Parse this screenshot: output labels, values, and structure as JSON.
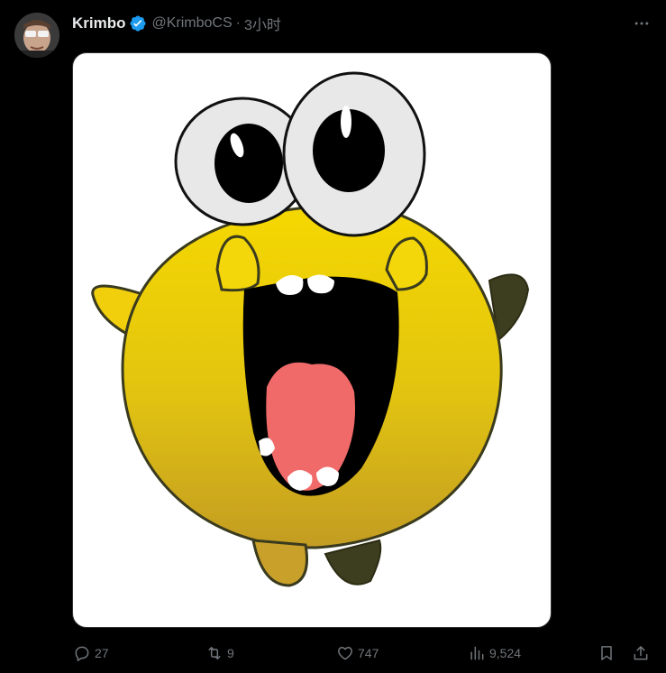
{
  "tweet": {
    "author": {
      "display_name": "Krimbo",
      "handle": "@KrimboCS",
      "verified": true
    },
    "separator": "·",
    "time": "3小时",
    "more_icon": "more-horizontal-icon",
    "media": {
      "kind": "image",
      "subject": "yellow cartoon creature"
    },
    "actions": {
      "reply": {
        "icon": "reply-icon",
        "count": "27"
      },
      "retweet": {
        "icon": "retweet-icon",
        "count": "9"
      },
      "like": {
        "icon": "heart-icon",
        "count": "747"
      },
      "views": {
        "icon": "views-chart-icon",
        "count": "9,524"
      },
      "bookmark": {
        "icon": "bookmark-icon"
      },
      "share": {
        "icon": "share-icon"
      }
    }
  },
  "colors": {
    "background": "#000000",
    "text_primary": "#e7e9ea",
    "text_secondary": "#71767b",
    "verified_blue": "#1d9bf0",
    "character_yellow": "#f2d20a",
    "character_dark": "#3a3a1e",
    "tongue": "#f0696a"
  }
}
